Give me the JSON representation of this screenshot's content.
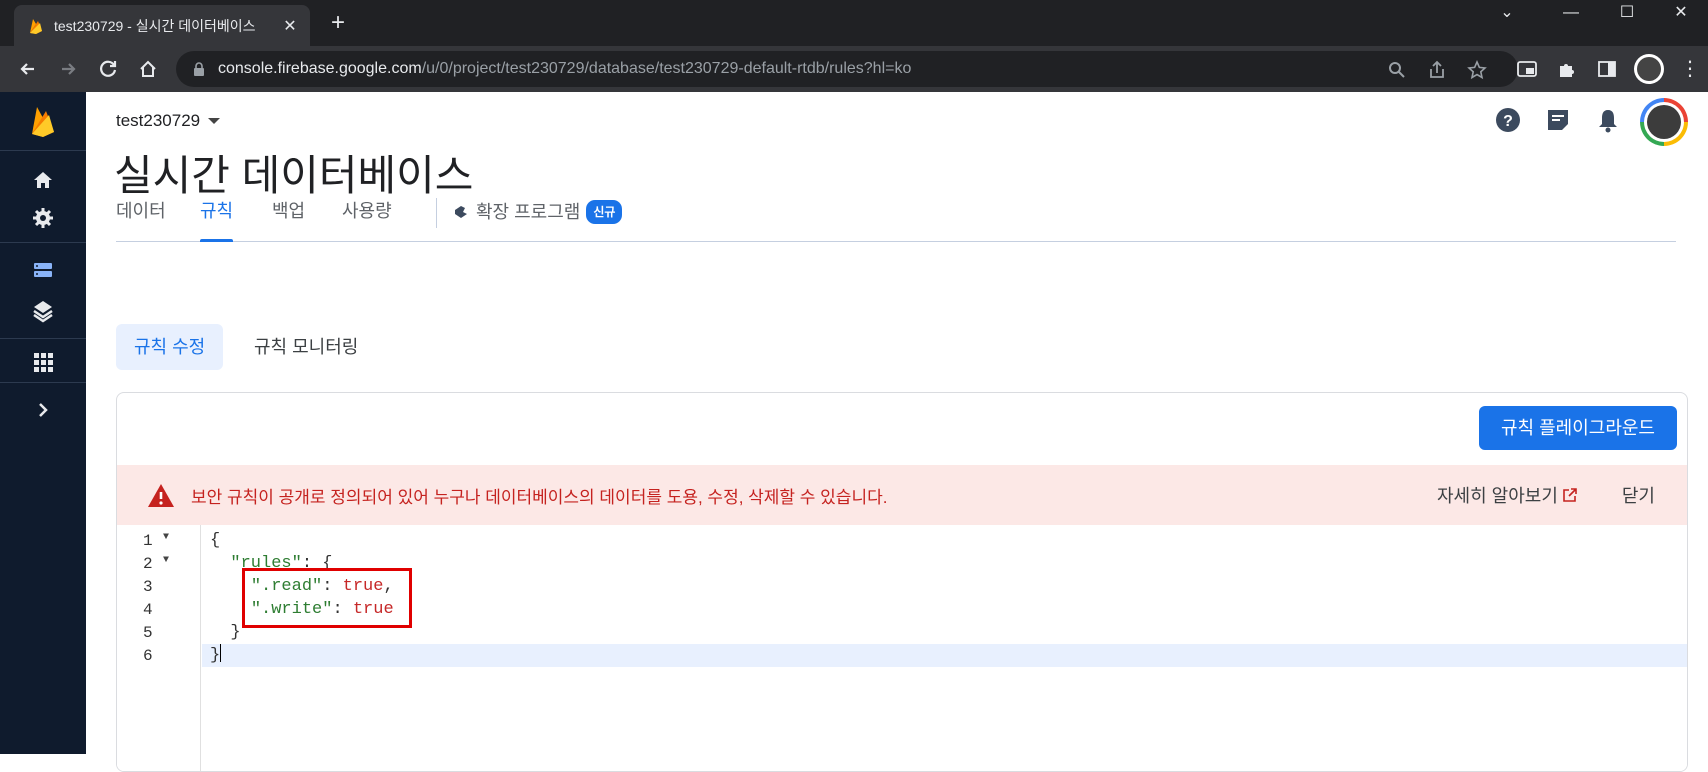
{
  "browser": {
    "tab_title": "test230729 - 실시간 데이터베이스",
    "tab_close": "✕",
    "new_tab": "+",
    "window_controls": {
      "minimize": "—",
      "maximize": "☐",
      "close": "✕",
      "chevron": "⌄"
    },
    "url_host": "console.firebase.google.com",
    "url_path": "/u/0/project/test230729/database/test230729-default-rtdb/rules?hl=ko"
  },
  "left_nav": {
    "icons": [
      "firebase-logo",
      "home-icon",
      "settings-icon",
      "database-icon",
      "extensions-stack-icon",
      "apps-grid-icon",
      "expand-chevron-icon"
    ]
  },
  "header": {
    "project_name": "test230729",
    "page_title": "실시간 데이터베이스"
  },
  "tabs": [
    {
      "label": "데이터"
    },
    {
      "label": "규칙",
      "active": true
    },
    {
      "label": "백업"
    },
    {
      "label": "사용량"
    },
    {
      "label": "확장 프로그램",
      "badge": "신규"
    }
  ],
  "subtabs": [
    {
      "label": "규칙 수정",
      "active": true
    },
    {
      "label": "규칙 모니터링"
    }
  ],
  "card": {
    "playground_button": "규칙 플레이그라운드",
    "warning_text": "보안 규칙이 공개로 정의되어 있어 누구나 데이터베이스의 데이터를 도용, 수정, 삭제할 수 있습니다.",
    "learn_more": "자세히 알아보기",
    "close": "닫기"
  },
  "editor": {
    "lines": [
      {
        "num": "1",
        "fold": "▼"
      },
      {
        "num": "2",
        "fold": "▼"
      },
      {
        "num": "3",
        "fold": ""
      },
      {
        "num": "4",
        "fold": ""
      },
      {
        "num": "5",
        "fold": ""
      },
      {
        "num": "6",
        "fold": ""
      }
    ],
    "code": {
      "open_brace": "{",
      "rules_key": "\"rules\"",
      "colon_open": ": {",
      "read_key": "\".read\"",
      "read_val": "true",
      "comma": ",",
      "write_key": "\".write\"",
      "write_val": "true",
      "colon": ": ",
      "inner_close": "}",
      "outer_close": "}"
    }
  },
  "colors": {
    "nav_bg": "#0f1b2d",
    "accent": "#1a73e8",
    "warning_bg": "#fce8e6",
    "warning_text": "#c5221f",
    "highlight_box": "#e00000"
  }
}
